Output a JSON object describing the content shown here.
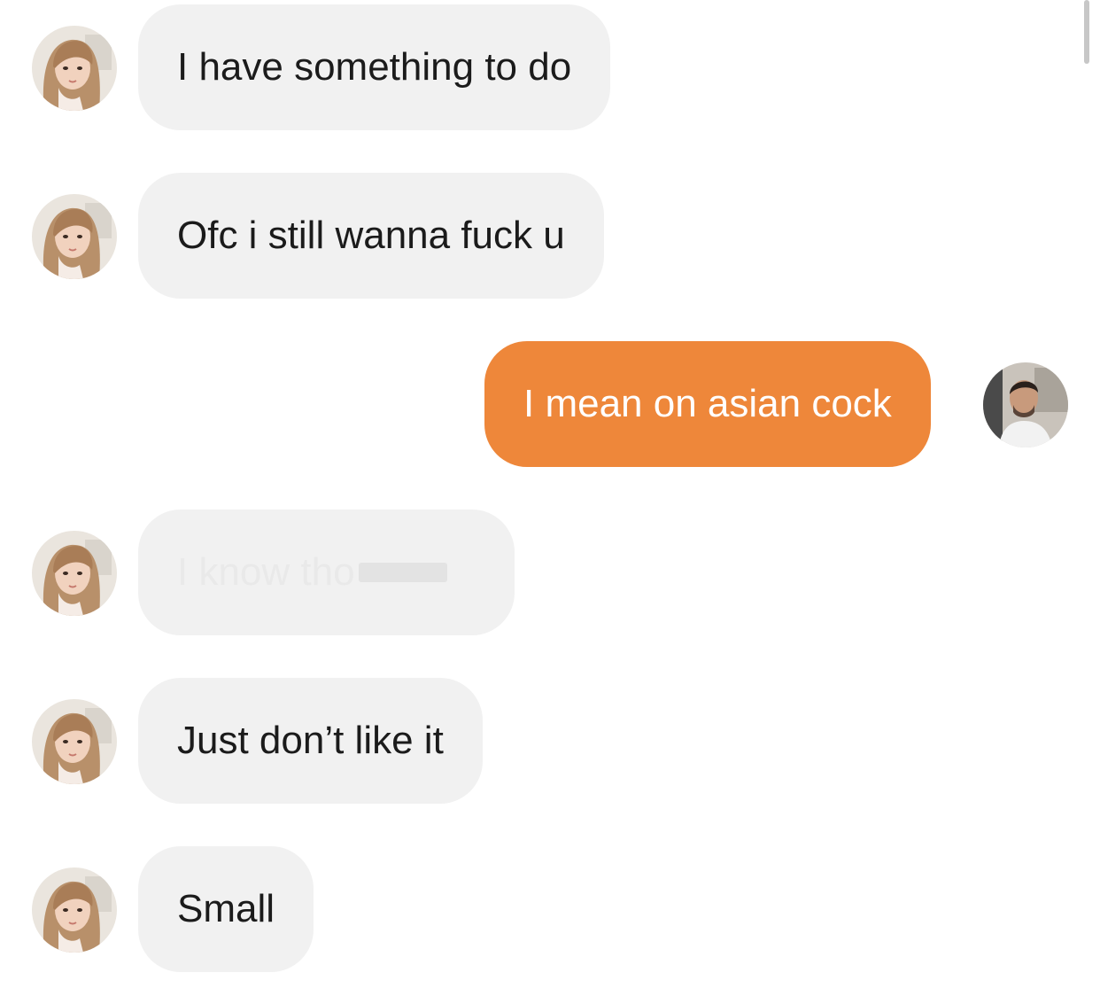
{
  "conversation": {
    "messages": [
      {
        "sender": "them",
        "text": "I have something to do"
      },
      {
        "sender": "them",
        "text": "Ofc i still wanna fuck u"
      },
      {
        "sender": "me",
        "text": "I mean on asian cock"
      },
      {
        "sender": "them",
        "text": "I know tho",
        "faded": true
      },
      {
        "sender": "them",
        "text": "Just don’t like it"
      },
      {
        "sender": "them",
        "text": "Small"
      }
    ]
  },
  "colors": {
    "incoming_bubble": "#f1f1f1",
    "outgoing_bubble": "#ee873a",
    "incoming_text": "#1b1b1b",
    "outgoing_text": "#ffffff"
  },
  "icons": {
    "them_avatar": "woman-avatar-icon",
    "me_avatar": "man-avatar-icon"
  }
}
